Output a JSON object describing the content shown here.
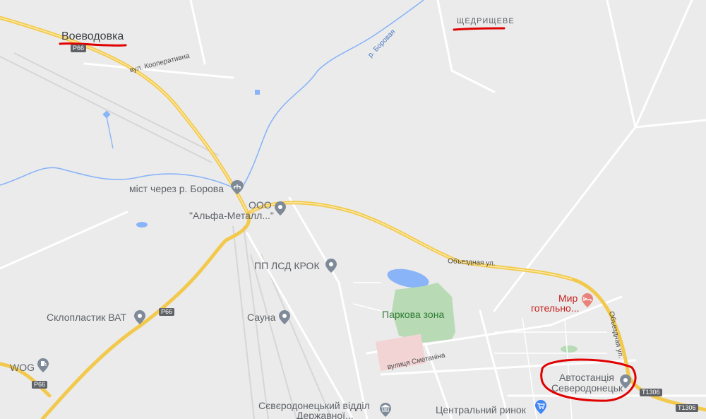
{
  "places": {
    "voevodovka": "Воеводовка",
    "shchedryshcheve": "ЩЕДРИЩЕВЕ"
  },
  "streets": {
    "koopertyvna": "вул. Кооперативна",
    "borova_river": "р. Боровая",
    "obyezdnaya_1": "Объездная ул.",
    "obyezdnaya_2": "Объездная ул.",
    "smetanina": "вулиця Сметаніна"
  },
  "pois": {
    "bridge": "міст через р. Борова",
    "alfa_metall_1": "ООО",
    "alfa_metall_2": "\"Альфа-Металл...\"",
    "lsd_krok": "ПП ЛСД КРОК",
    "sklopl": "Склопластик ВАТ",
    "sauna": "Сауна",
    "park": "Паркова зона",
    "wog": "WOG",
    "hotel_1": "Мир",
    "hotel_2": "готельно...",
    "bus_1": "Автостанція",
    "bus_2": "Северодонецьк",
    "archive_1": "Сєвєродонецький відділ",
    "archive_2": "Державної...",
    "market": "Центральний ринок"
  },
  "shields": {
    "p66_a": "Р66",
    "p66_b": "Р66",
    "p66_c": "Р66",
    "t1306_a": "Т1306",
    "t1306_b": "Т1306"
  },
  "colors": {
    "land": "#ebebeb",
    "road": "#ffffff",
    "highway": "#f2c94c",
    "water": "#8ab4f8",
    "park": "#b8dab5",
    "annotation": "#e00000"
  },
  "icons": [
    "location-pin-icon",
    "bridge-icon",
    "hotel-bed-icon",
    "fuel-icon",
    "shopping-cart-icon",
    "museum-icon"
  ]
}
